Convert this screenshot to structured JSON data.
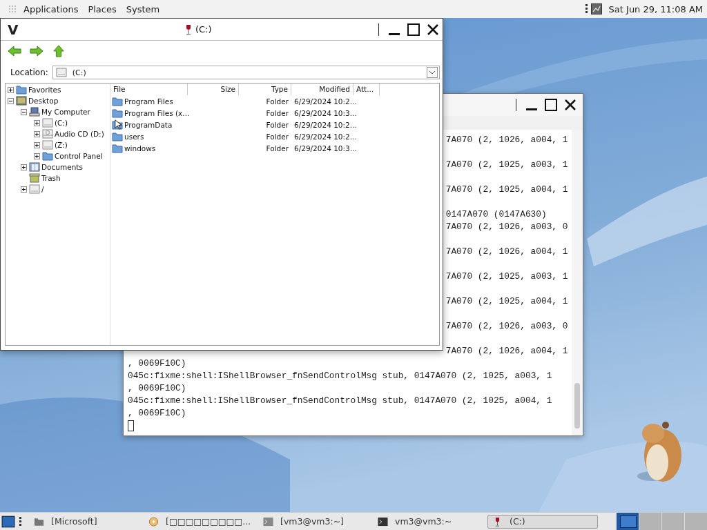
{
  "top_panel": {
    "menus": [
      "Applications",
      "Places",
      "System"
    ],
    "clock": "Sat Jun 29, 11:08 AM"
  },
  "explorer": {
    "menu_glyph": "V",
    "title": "(C:)",
    "location_label": "Location:",
    "location_value": "(C:)",
    "tree": [
      {
        "kind": "favorites",
        "label": "Favorites",
        "expanded": false
      },
      {
        "kind": "desktop",
        "label": "Desktop",
        "expanded": true,
        "children": [
          {
            "kind": "computer",
            "label": "My Computer",
            "expanded": true,
            "children": [
              {
                "kind": "drive",
                "label": "(C:)",
                "expanded": false
              },
              {
                "kind": "cdrom",
                "label": "Audio CD (D:)",
                "expanded": false
              },
              {
                "kind": "drive",
                "label": "(Z:)",
                "expanded": false
              },
              {
                "kind": "folder",
                "label": "Control Panel",
                "expanded": false
              }
            ]
          },
          {
            "kind": "documents",
            "label": "Documents",
            "expanded": false
          },
          {
            "kind": "trash",
            "label": "Trash"
          },
          {
            "kind": "drive",
            "label": "/",
            "expanded": false
          }
        ]
      }
    ],
    "columns": [
      "File",
      "Size",
      "Type",
      "Modified",
      "Att..."
    ],
    "files": [
      {
        "name": "Program Files",
        "type": "Folder",
        "modified": "6/29/2024 10:2..."
      },
      {
        "name": "Program Files (x...",
        "type": "Folder",
        "modified": "6/29/2024 10:3..."
      },
      {
        "name": "ProgramData",
        "type": "Folder",
        "modified": "6/29/2024 10:2..."
      },
      {
        "name": "users",
        "type": "Folder",
        "modified": "6/29/2024 10:2..."
      },
      {
        "name": "windows",
        "type": "Folder",
        "modified": "6/29/2024 10:3..."
      }
    ]
  },
  "terminal": {
    "lines": [
      {
        "kind": "tail",
        "text": "7A070 (2, 1026, a004, 1"
      },
      {
        "kind": "gap"
      },
      {
        "kind": "tail",
        "text": "7A070 (2, 1025, a003, 1"
      },
      {
        "kind": "gap"
      },
      {
        "kind": "tail",
        "text": "7A070 (2, 1025, a004, 1"
      },
      {
        "kind": "gap"
      },
      {
        "kind": "tail",
        "text": "0147A070 (0147A630)"
      },
      {
        "kind": "tail",
        "text": "7A070 (2, 1026, a003, 0"
      },
      {
        "kind": "gap"
      },
      {
        "kind": "tail",
        "text": "7A070 (2, 1026, a004, 1"
      },
      {
        "kind": "gap"
      },
      {
        "kind": "tail",
        "text": "7A070 (2, 1025, a003, 1"
      },
      {
        "kind": "gap"
      },
      {
        "kind": "tail",
        "text": "7A070 (2, 1025, a004, 1"
      },
      {
        "kind": "gap"
      },
      {
        "kind": "tail",
        "text": "7A070 (2, 1026, a003, 0"
      },
      {
        "kind": "gap"
      },
      {
        "kind": "tail",
        "text": "7A070 (2, 1026, a004, 1"
      },
      {
        "kind": "full",
        "text": ", 0069F10C)"
      },
      {
        "kind": "full",
        "text": "045c:fixme:shell:IShellBrowser_fnSendControlMsg stub, 0147A070 (2, 1025, a003, 1"
      },
      {
        "kind": "full",
        "text": ", 0069F10C)"
      },
      {
        "kind": "full",
        "text": "045c:fixme:shell:IShellBrowser_fnSendControlMsg stub, 0147A070 (2, 1025, a004, 1"
      },
      {
        "kind": "full",
        "text": ", 0069F10C)"
      },
      {
        "kind": "cursor"
      }
    ]
  },
  "taskbar": {
    "tasks": [
      {
        "kind": "folder",
        "label": "[Microsoft]",
        "selected": false
      },
      {
        "kind": "wine",
        "label": "[□□□□□□□□□...",
        "selected": false
      },
      {
        "kind": "terminal",
        "label": "[vm3@vm3:~]",
        "selected": false
      },
      {
        "kind": "terminal-dark",
        "label": "vm3@vm3:~",
        "selected": false
      },
      {
        "kind": "glass",
        "label": "(C:)",
        "selected": true
      }
    ],
    "workspaces": [
      {
        "selected": true
      },
      {
        "selected": false
      },
      {
        "selected": false
      },
      {
        "selected": false
      }
    ]
  }
}
